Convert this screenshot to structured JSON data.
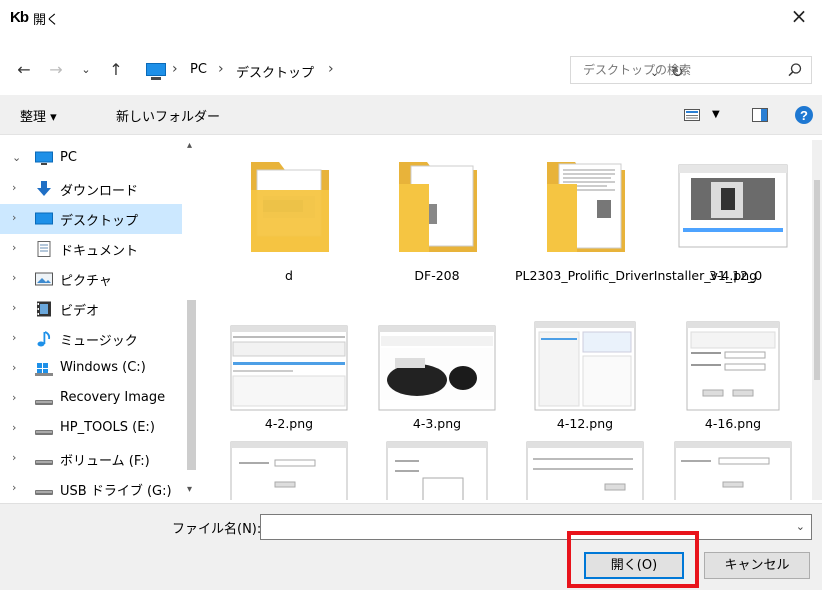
{
  "window": {
    "app_logo": "Kb",
    "title": "開く",
    "close_label": "×"
  },
  "address_bar": {
    "crumbs": [
      "PC",
      "デスクトップ"
    ],
    "search_placeholder": "デスクトップの検索"
  },
  "toolbar": {
    "organize_label": "整理 ▾",
    "new_folder_label": "新しいフォルダー",
    "help_label": "?"
  },
  "nav": {
    "items": [
      {
        "label": "PC",
        "chevron": "⌄",
        "icon": "monitor-icon"
      },
      {
        "label": "ダウンロード",
        "chevron": "›",
        "icon": "download-arrow-icon"
      },
      {
        "label": "デスクトップ",
        "chevron": "›",
        "icon": "desktop-icon",
        "selected": true
      },
      {
        "label": "ドキュメント",
        "chevron": "›",
        "icon": "document-icon"
      },
      {
        "label": "ピクチャ",
        "chevron": "›",
        "icon": "picture-icon"
      },
      {
        "label": "ビデオ",
        "chevron": "›",
        "icon": "video-icon"
      },
      {
        "label": "ミュージック",
        "chevron": "›",
        "icon": "music-note-icon"
      },
      {
        "label": "Windows (C:)",
        "chevron": "›",
        "icon": "windows-drive-icon"
      },
      {
        "label": "Recovery Image",
        "chevron": "›",
        "icon": "drive-icon"
      },
      {
        "label": "HP_TOOLS (E:)",
        "chevron": "›",
        "icon": "drive-icon"
      },
      {
        "label": "ボリューム (F:)",
        "chevron": "›",
        "icon": "drive-icon"
      },
      {
        "label": "USB ドライブ (G:)",
        "chevron": "›",
        "icon": "usb-drive-icon"
      }
    ]
  },
  "files": [
    {
      "name": "d",
      "kind": "folder"
    },
    {
      "name": "DF-208",
      "kind": "folder"
    },
    {
      "name": "PL2303_Prolific_DriverInstaller_v1_12_0",
      "kind": "folder"
    },
    {
      "name": "3-4.png",
      "kind": "image"
    },
    {
      "name": "4-2.png",
      "kind": "image"
    },
    {
      "name": "4-3.png",
      "kind": "image"
    },
    {
      "name": "4-12.png",
      "kind": "image"
    },
    {
      "name": "4-16.png",
      "kind": "image"
    },
    {
      "name": "",
      "kind": "image"
    },
    {
      "name": "",
      "kind": "image"
    },
    {
      "name": "",
      "kind": "image"
    },
    {
      "name": "",
      "kind": "image"
    }
  ],
  "bottom": {
    "filename_label": "ファイル名(N):",
    "filename_value": "",
    "open_label": "開く(O)",
    "cancel_label": "キャンセル"
  },
  "colors": {
    "selection": "#cce8ff",
    "accent": "#0078d7",
    "highlight": "#e8131b",
    "folder": "#f5c542"
  }
}
